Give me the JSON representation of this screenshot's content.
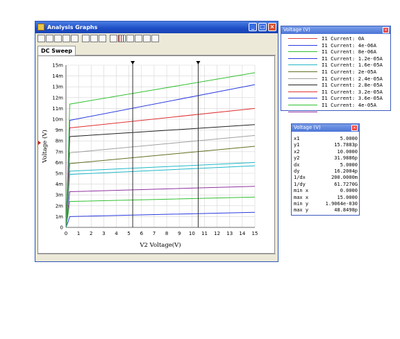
{
  "window": {
    "title": "Analysis Graphs",
    "tab": "DC Sweep"
  },
  "toolbar_icons": [
    "new-icon",
    "open-icon",
    "save-icon",
    "print-icon",
    "print-preview-icon",
    "cut-icon",
    "copy-icon",
    "paste-icon",
    "properties-icon",
    "grid-icon",
    "legend-icon",
    "cursors-icon",
    "zoom-icon",
    "overview-icon"
  ],
  "legend_window": {
    "title": "Voltage (V)",
    "entries": [
      {
        "label": "I1 Current: 0A",
        "color": "#e04040"
      },
      {
        "label": "I1 Current: 4e-06A",
        "color": "#2a3ae0"
      },
      {
        "label": "I1 Current: 8e-06A",
        "color": "#30c030"
      },
      {
        "label": "I1 Current: 1.2e-05A",
        "color": "#2a3ae0"
      },
      {
        "label": "I1 Current: 1.6e-05A",
        "color": "#20b8c8"
      },
      {
        "label": "I1 Current: 2e-05A",
        "color": "#607020"
      },
      {
        "label": "I1 Current: 2.4e-05A",
        "color": "#a0a0a0"
      },
      {
        "label": "I1 Current: 2.8e-05A",
        "color": "#202020"
      },
      {
        "label": "I1 Current: 3.2e-05A",
        "color": "#e03030"
      },
      {
        "label": "I1 Current: 3.6e-05A",
        "color": "#2a3ae0"
      },
      {
        "label": "I1 Current: 4e-05A",
        "color": "#30c030"
      }
    ]
  },
  "readout_window": {
    "title": "Voltage (V)",
    "rows": [
      {
        "k": "x1",
        "v": "5.0000"
      },
      {
        "k": "y1",
        "v": "15.7883p"
      },
      {
        "k": "x2",
        "v": "10.0000"
      },
      {
        "k": "y2",
        "v": "31.9886p"
      },
      {
        "k": "dx",
        "v": "5.0000"
      },
      {
        "k": "dy",
        "v": "16.2004p"
      },
      {
        "k": "1/dx",
        "v": "200.0000m"
      },
      {
        "k": "1/dy",
        "v": "61.7270G"
      },
      {
        "k": "min x",
        "v": "0.0000"
      },
      {
        "k": "max x",
        "v": "15.0000"
      },
      {
        "k": "min y",
        "v": "1.9064e-030"
      },
      {
        "k": "max y",
        "v": "48.8498p"
      }
    ]
  },
  "chart_data": {
    "type": "line",
    "xlabel": "V2 Voltage(V)",
    "ylabel": "Voltage (V)",
    "xlim": [
      0,
      15
    ],
    "ylim": [
      0,
      15
    ],
    "x_ticks": [
      "0",
      "1",
      "2",
      "3",
      "4",
      "5",
      "6",
      "7",
      "8",
      "9",
      "10",
      "11",
      "12",
      "13",
      "14",
      "15"
    ],
    "y_ticks": [
      "0",
      "1m",
      "2m",
      "3m",
      "4m",
      "5m",
      "6m",
      "7m",
      "8m",
      "9m",
      "10m",
      "11m",
      "12m",
      "13m",
      "14m",
      "15m"
    ],
    "y_unit": "mV",
    "grid": true,
    "cursors_x": [
      5.3,
      10.5
    ],
    "series": [
      {
        "color": "#2a3ae0",
        "start": 1.0,
        "end": 1.4
      },
      {
        "color": "#30c030",
        "start": 2.4,
        "end": 2.8
      },
      {
        "color": "#9030a0",
        "start": 3.3,
        "end": 3.8
      },
      {
        "color": "#20b8c8",
        "start": 4.9,
        "end": 5.7
      },
      {
        "color": "#20b8c8",
        "start": 5.2,
        "end": 6.0
      },
      {
        "color": "#607020",
        "start": 5.9,
        "end": 7.5
      },
      {
        "color": "#a0a0a0",
        "start": 6.9,
        "end": 8.5
      },
      {
        "color": "#202020",
        "start": 8.4,
        "end": 9.5
      },
      {
        "color": "#e03030",
        "start": 9.2,
        "end": 11.0
      },
      {
        "color": "#2a3ae0",
        "start": 9.9,
        "end": 13.2
      },
      {
        "color": "#30c030",
        "start": 11.4,
        "end": 14.3
      }
    ]
  }
}
